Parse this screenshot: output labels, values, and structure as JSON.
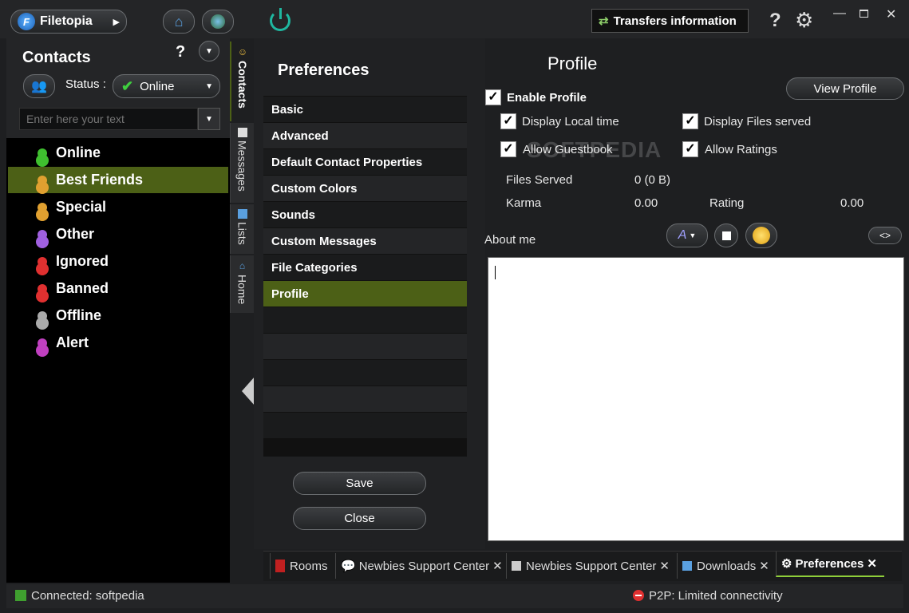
{
  "app": {
    "title": "Filetopia",
    "transfers_label": "Transfers information"
  },
  "contacts": {
    "title": "Contacts",
    "help": "?",
    "status_label": "Status :",
    "status_value": "Online",
    "search_placeholder": "Enter here your text",
    "groups": [
      {
        "label": "Online",
        "color": "#3fbf2f"
      },
      {
        "label": "Best Friends",
        "color": "#e0a030"
      },
      {
        "label": "Special",
        "color": "#e0a030"
      },
      {
        "label": "Other",
        "color": "#a060e0"
      },
      {
        "label": "Ignored",
        "color": "#e03030"
      },
      {
        "label": "Banned",
        "color": "#e03030"
      },
      {
        "label": "Offline",
        "color": "#aaaaaa"
      },
      {
        "label": "Alert",
        "color": "#c040c0"
      }
    ]
  },
  "vtabs": [
    "Contacts",
    "Messages",
    "Lists",
    "Home"
  ],
  "preferences": {
    "title": "Preferences",
    "items": [
      "Basic",
      "Advanced",
      "Default Contact Properties",
      "Custom Colors",
      "Sounds",
      "Custom Messages",
      "File Categories",
      "Profile"
    ],
    "save": "Save",
    "close": "Close"
  },
  "profile": {
    "title": "Profile",
    "view_profile": "View Profile",
    "enable": "Enable Profile",
    "display_local_time": "Display Local time",
    "display_files_served": "Display Files served",
    "allow_guestbook": "Allow Guestbook",
    "allow_ratings": "Allow Ratings",
    "files_served_label": "Files Served",
    "files_served_value": "0 (0 B)",
    "karma_label": "Karma",
    "karma_value": "0.00",
    "rating_label": "Rating",
    "rating_value": "0.00",
    "about_me": "About me",
    "code_btn": "<>"
  },
  "tabs": [
    "Rooms",
    "Newbies Support Center",
    "Newbies Support Center",
    "Downloads",
    "Preferences"
  ],
  "status": {
    "connected": "Connected: softpedia",
    "p2p": "P2P: Limited connectivity"
  },
  "watermark": "SOFTPEDIA"
}
